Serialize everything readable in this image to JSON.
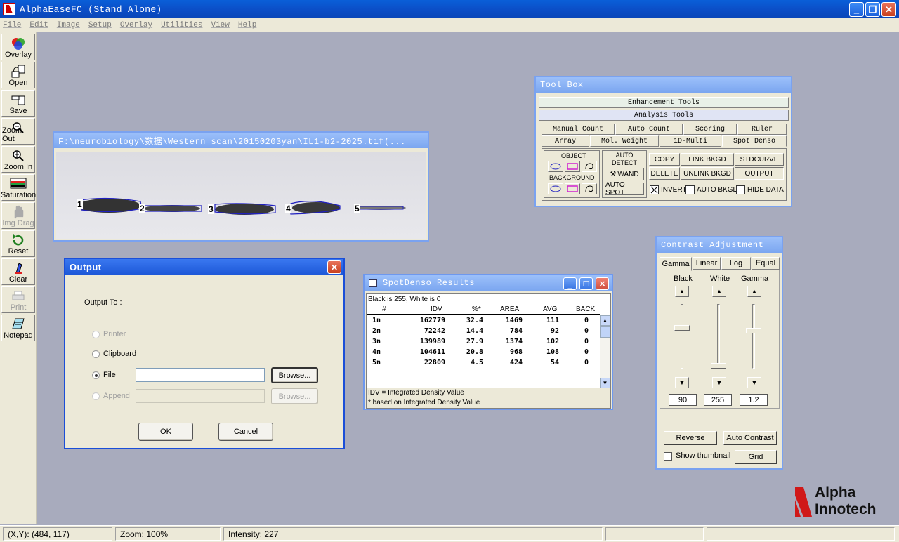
{
  "app": {
    "title": "AlphaEaseFC (Stand Alone)",
    "logo_line1": "Alpha",
    "logo_line2": "Innotech"
  },
  "menu": [
    "File",
    "Edit",
    "Image",
    "Setup",
    "Overlay",
    "Utilities",
    "View",
    "Help"
  ],
  "toolbar": [
    {
      "label": "Overlay",
      "icon": "overlay-icon",
      "enabled": true
    },
    {
      "label": "Open",
      "icon": "open-icon",
      "enabled": true
    },
    {
      "label": "Save",
      "icon": "save-icon",
      "enabled": true
    },
    {
      "label": "Zoom Out",
      "icon": "zoom-out-icon",
      "enabled": true
    },
    {
      "label": "Zoom In",
      "icon": "zoom-in-icon",
      "enabled": true
    },
    {
      "label": "Saturation",
      "icon": "saturation-icon",
      "enabled": true
    },
    {
      "label": "Img Drag",
      "icon": "hand-icon",
      "enabled": false
    },
    {
      "label": "Reset",
      "icon": "reset-icon",
      "enabled": true
    },
    {
      "label": "Clear",
      "icon": "clear-icon",
      "enabled": true
    },
    {
      "label": "Print",
      "icon": "print-icon",
      "enabled": false
    },
    {
      "label": "Notepad",
      "icon": "notepad-icon",
      "enabled": true
    }
  ],
  "image_window": {
    "title": "F:\\neurobiology\\数据\\Western scan\\20150203yan\\IL1-b2-2025.tif(...",
    "bands": [
      "1",
      "2",
      "3",
      "4",
      "5"
    ]
  },
  "toolbox": {
    "title": "Tool Box",
    "section1": "Enhancement Tools",
    "section2": "Analysis Tools",
    "tabs_row1": [
      "Manual Count",
      "Auto Count",
      "Scoring",
      "Ruler"
    ],
    "tabs_row2": [
      "Array",
      "Mol. Weight",
      "1D-Multi",
      "Spot Denso"
    ],
    "object_label": "OBJECT",
    "background_label": "BACKGROUND",
    "auto_detect": "AUTO\nDETECT",
    "wand": "WAND",
    "auto_spot": "AUTO SPOT",
    "buttons": {
      "copy": "COPY",
      "link_bkgd": "LINK BKGD",
      "stdcurve": "STDCURVE",
      "delete": "DELETE",
      "unlink_bkgd": "UNLINK BKGD",
      "output": "OUTPUT"
    },
    "checks": {
      "invert": "INVERT",
      "auto_bkgd": "AUTO BKGD",
      "hide_data": "HIDE DATA"
    }
  },
  "output_dialog": {
    "title": "Output",
    "output_to": "Output To :",
    "printer": "Printer",
    "clipboard": "Clipboard",
    "file": "File",
    "append": "Append",
    "browse": "Browse...",
    "browse2": "Browse...",
    "ok": "OK",
    "cancel": "Cancel",
    "file_value": "",
    "append_value": ""
  },
  "results": {
    "title": "SpotDenso Results",
    "header_note": "Black is 255, White is 0",
    "columns": [
      "#",
      "IDV",
      "%*",
      "AREA",
      "AVG",
      "BACK"
    ],
    "rows": [
      [
        "1n",
        "162779",
        "32.4",
        "1469",
        "111",
        "0"
      ],
      [
        "2n",
        "72242",
        "14.4",
        "784",
        "92",
        "0"
      ],
      [
        "3n",
        "139989",
        "27.9",
        "1374",
        "102",
        "0"
      ],
      [
        "4n",
        "104611",
        "20.8",
        "968",
        "108",
        "0"
      ],
      [
        "5n",
        "22809",
        "4.5",
        "424",
        "54",
        "0"
      ]
    ],
    "footnote1": "IDV = Integrated Density Value",
    "footnote2": "* based on Integrated Density Value"
  },
  "contrast": {
    "title": "Contrast Adjustment",
    "tabs": [
      "Gamma",
      "Linear",
      "Log",
      "Equal"
    ],
    "labels": [
      "Black",
      "White",
      "Gamma"
    ],
    "values": [
      "90",
      "255",
      "1.2"
    ],
    "reverse": "Reverse",
    "auto_contrast": "Auto Contrast",
    "show_thumbnail": "Show thumbnail",
    "grid": "Grid"
  },
  "status": {
    "xy": "(X,Y): (484, 117)",
    "zoom": "Zoom: 100%",
    "intensity": "Intensity: 227"
  }
}
